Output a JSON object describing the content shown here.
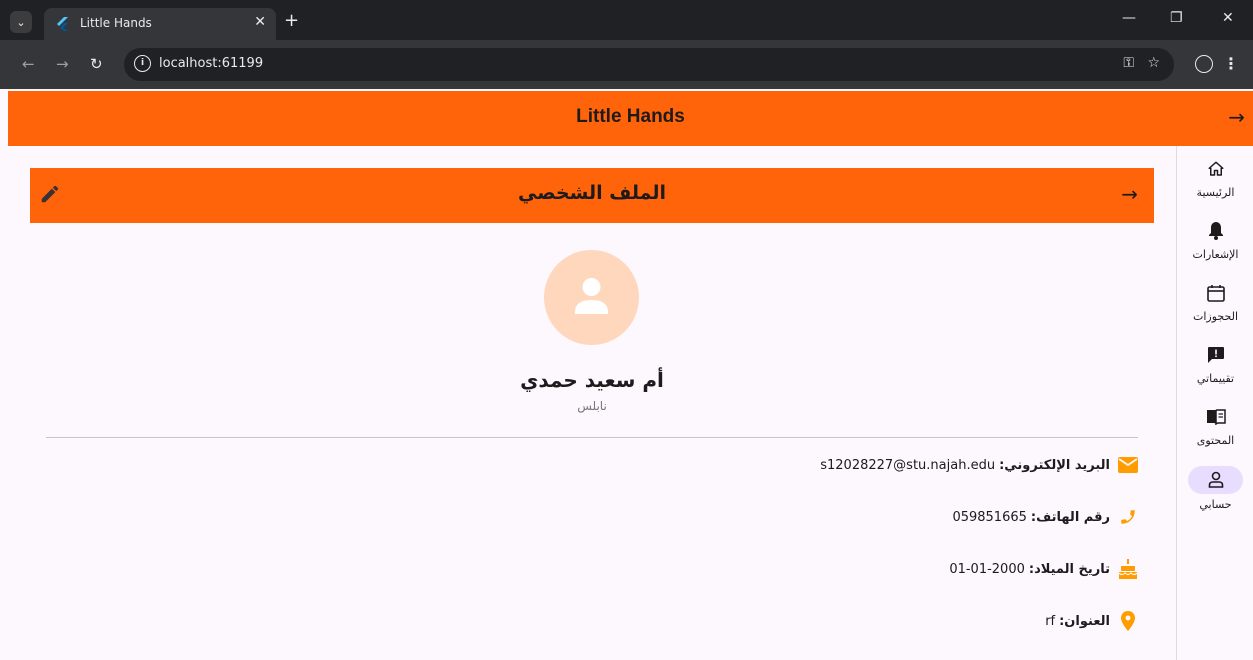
{
  "browser": {
    "tab_title": "Little Hands",
    "url": "localhost:61199"
  },
  "app": {
    "title": "Little Hands"
  },
  "nav": {
    "items": [
      {
        "label": "الرئيسية",
        "icon": "home-icon"
      },
      {
        "label": "الإشعارات",
        "icon": "bell-icon"
      },
      {
        "label": "الحجوزات",
        "icon": "calendar-icon"
      },
      {
        "label": "تقييماتي",
        "icon": "feedback-icon"
      },
      {
        "label": "المحتوى",
        "icon": "book-icon"
      },
      {
        "label": "حسابي",
        "icon": "person-icon",
        "selected": true
      }
    ]
  },
  "profile": {
    "header_title": "الملف الشخصي",
    "name": "أم سعيد حمدي",
    "city": "نابلس",
    "fields": [
      {
        "label": "البريد الإلكتروني:",
        "value": "s12028227@stu.najah.edu",
        "icon": "mail-icon"
      },
      {
        "label": "رقم الهاتف:",
        "value": "059851665",
        "icon": "phone-icon"
      },
      {
        "label": "تاريخ الميلاد:",
        "value": "01-01-2000",
        "icon": "cake-icon"
      },
      {
        "label": "العنوان:",
        "value": "rf",
        "icon": "location-icon"
      }
    ]
  },
  "colors": {
    "primary": "#ff640a",
    "accent_icon": "#ff9d00",
    "avatar_bg": "#ffd7bd",
    "nav_selected": "#e9ddff",
    "background": "#fdf7fe"
  }
}
